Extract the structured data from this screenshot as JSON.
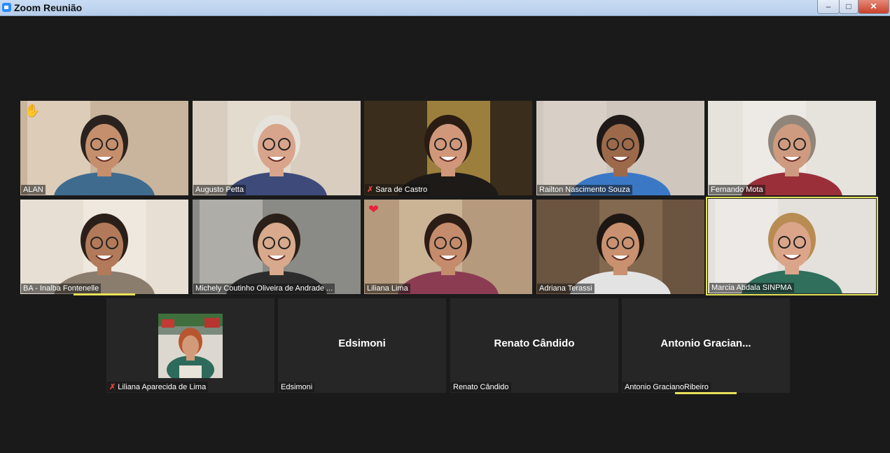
{
  "window": {
    "title": "Zoom Reunião",
    "controls": {
      "minimize": "–",
      "maximize": "□",
      "close": "✕"
    }
  },
  "participants_row1": [
    {
      "name": "ALAN",
      "muted": false,
      "reaction": "✋",
      "bg": "#c9b59d",
      "wall": "#e4d6c3",
      "shirt": "#3f6b8f",
      "skin": "#c58f6d",
      "hair": "#2a221e"
    },
    {
      "name": "Augusto Petta",
      "muted": false,
      "reaction": "",
      "bg": "#d8cdbf",
      "wall": "#e9e1d6",
      "shirt": "#3d4a7a",
      "skin": "#d9a48c",
      "hair": "#e6e2dc"
    },
    {
      "name": "Sara de Castro",
      "muted": true,
      "reaction": "",
      "bg": "#3a2d1b",
      "wall": "#c8a34c",
      "shirt": "#1d1a18",
      "skin": "#d0977a",
      "hair": "#2a1c12"
    },
    {
      "name": "Railton Nascimento Souza",
      "muted": false,
      "reaction": "",
      "bg": "#cfc6bd",
      "wall": "#dcd4cb",
      "shirt": "#3a78c6",
      "skin": "#9c6a4b",
      "hair": "#1f1a17"
    },
    {
      "name": "Fernando Mota",
      "muted": false,
      "reaction": "",
      "bg": "#e6e2dc",
      "wall": "#efece8",
      "shirt": "#9a2f3a",
      "skin": "#cf9b80",
      "hair": "#8f857a"
    }
  ],
  "participants_row2": [
    {
      "name": "BA - Inalba Fontenelle",
      "muted": false,
      "reaction": "",
      "bg": "#e8dfd4",
      "wall": "#f1ebe4",
      "shirt": "#8b7d6e",
      "skin": "#b27a5a",
      "hair": "#2b2019"
    },
    {
      "name": "Michely Coutinho Oliveira de Andrade ...",
      "muted": false,
      "reaction": "",
      "bg": "#8a8a86",
      "wall": "#bdbcb7",
      "shirt": "#2c2c2c",
      "skin": "#d8a98c",
      "hair": "#2a1f19"
    },
    {
      "name": "Liliana Lima",
      "muted": false,
      "reaction": "❤",
      "bg": "#b69a7d",
      "wall": "#d4bda1",
      "shirt": "#8b3c52",
      "skin": "#c48c6c",
      "hair": "#2c1c16"
    },
    {
      "name": "Adriana Terassi",
      "muted": false,
      "reaction": "",
      "bg": "#6b5440",
      "wall": "#8c7256",
      "shirt": "#e3e3e3",
      "skin": "#c9916f",
      "hair": "#1e1612"
    },
    {
      "name": "Marcia Abdala SINPMA",
      "muted": false,
      "reaction": "",
      "bg": "#e4e1dc",
      "wall": "#efede9",
      "shirt": "#2f6f5c",
      "skin": "#dba58a",
      "hair": "#b88c52"
    }
  ],
  "participants_row3": [
    {
      "name": "Liliana Aparecida de Lima",
      "muted": true,
      "label": "",
      "photo": true
    },
    {
      "name": "Edsimoni",
      "muted": false,
      "label": "Edsimoni",
      "photo": false
    },
    {
      "name": "Renato Cândido",
      "muted": false,
      "label": "Renato Cândido",
      "photo": false
    },
    {
      "name": "Antonio GracianoRibeiro",
      "muted": false,
      "label": "Antonio  Gracian...",
      "photo": false
    }
  ],
  "active_speaker": "Marcia Abdala SINPMA",
  "colors": {
    "active_outline": "#e3e25a",
    "mute_icon": "#e0463c",
    "background": "#1a1a1a",
    "tile": "#262626"
  }
}
